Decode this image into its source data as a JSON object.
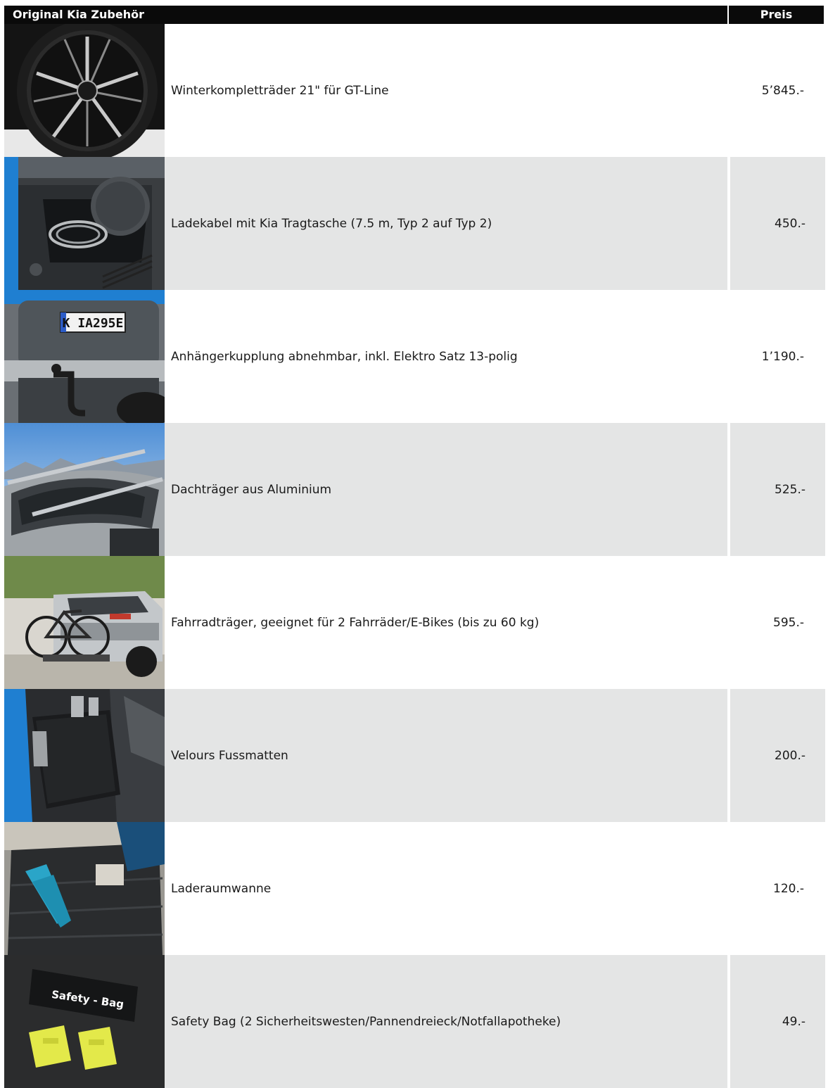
{
  "header": {
    "title": "Original Kia Zubehör",
    "price_label": "Preis"
  },
  "rows": [
    {
      "label": "Winterkompletträder 21\" für GT-Line",
      "price": "5’845.-",
      "image": "alloy-wheel"
    },
    {
      "label": "Ladekabel mit Kia Tragtasche (7.5 m, Typ 2 auf Typ 2)",
      "price": "450.-",
      "image": "charging-cable-bag"
    },
    {
      "label": "Anhängerkupplung abnehmbar, inkl. Elektro Satz 13-polig",
      "price": "1’190.-",
      "image": "tow-hitch",
      "plate_text": "K IA295E"
    },
    {
      "label": "Dachträger aus Aluminium",
      "price": "525.-",
      "image": "roof-rack"
    },
    {
      "label": "Fahrradträger, geeignet für 2 Fahrräder/E-Bikes (bis zu 60 kg)",
      "price": "595.-",
      "image": "bike-carrier"
    },
    {
      "label": "Velours Fussmatten",
      "price": "200.-",
      "image": "floor-mats"
    },
    {
      "label": "Laderaumwanne",
      "price": "120.-",
      "image": "trunk-liner"
    },
    {
      "label": "Safety Bag (2 Sicherheitswesten/Pannendreieck/Notfallapotheke)",
      "price": "49.-",
      "image": "safety-bag",
      "bag_text": "Safety - Bag"
    }
  ],
  "colors": {
    "header_bg": "#0a0a0a",
    "row_shade": "#e4e5e5",
    "accent_blue": "#1f7fd1",
    "vest_yellow": "#e3e94a"
  }
}
